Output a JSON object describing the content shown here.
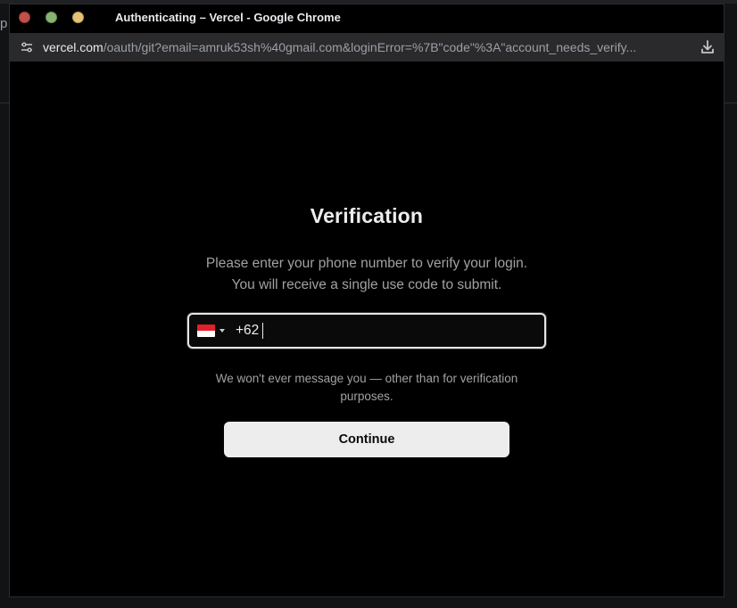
{
  "background": {
    "edge_letter": "p"
  },
  "window": {
    "title": "Authenticating – Vercel - Google Chrome"
  },
  "addressbar": {
    "url_host": "vercel.com",
    "url_path": "/oauth/git?email=amruk53sh%40gmail.com&loginError=%7B\"code\"%3A\"account_needs_verify..."
  },
  "verification": {
    "heading": "Verification",
    "line1": "Please enter your phone number to verify your login.",
    "line2": "You will receive a single use code to submit.",
    "phone": {
      "country_flag": "indonesia-flag",
      "value": "+62"
    },
    "note": "We won't ever message you — other than for verification purposes.",
    "continue_label": "Continue"
  },
  "colors": {
    "page_bg": "#000000",
    "heading": "#ededed",
    "muted_text": "#a1a1a1",
    "button_bg": "#ededed",
    "button_text": "#0a0a0a",
    "input_border": "#e6e6e6"
  }
}
